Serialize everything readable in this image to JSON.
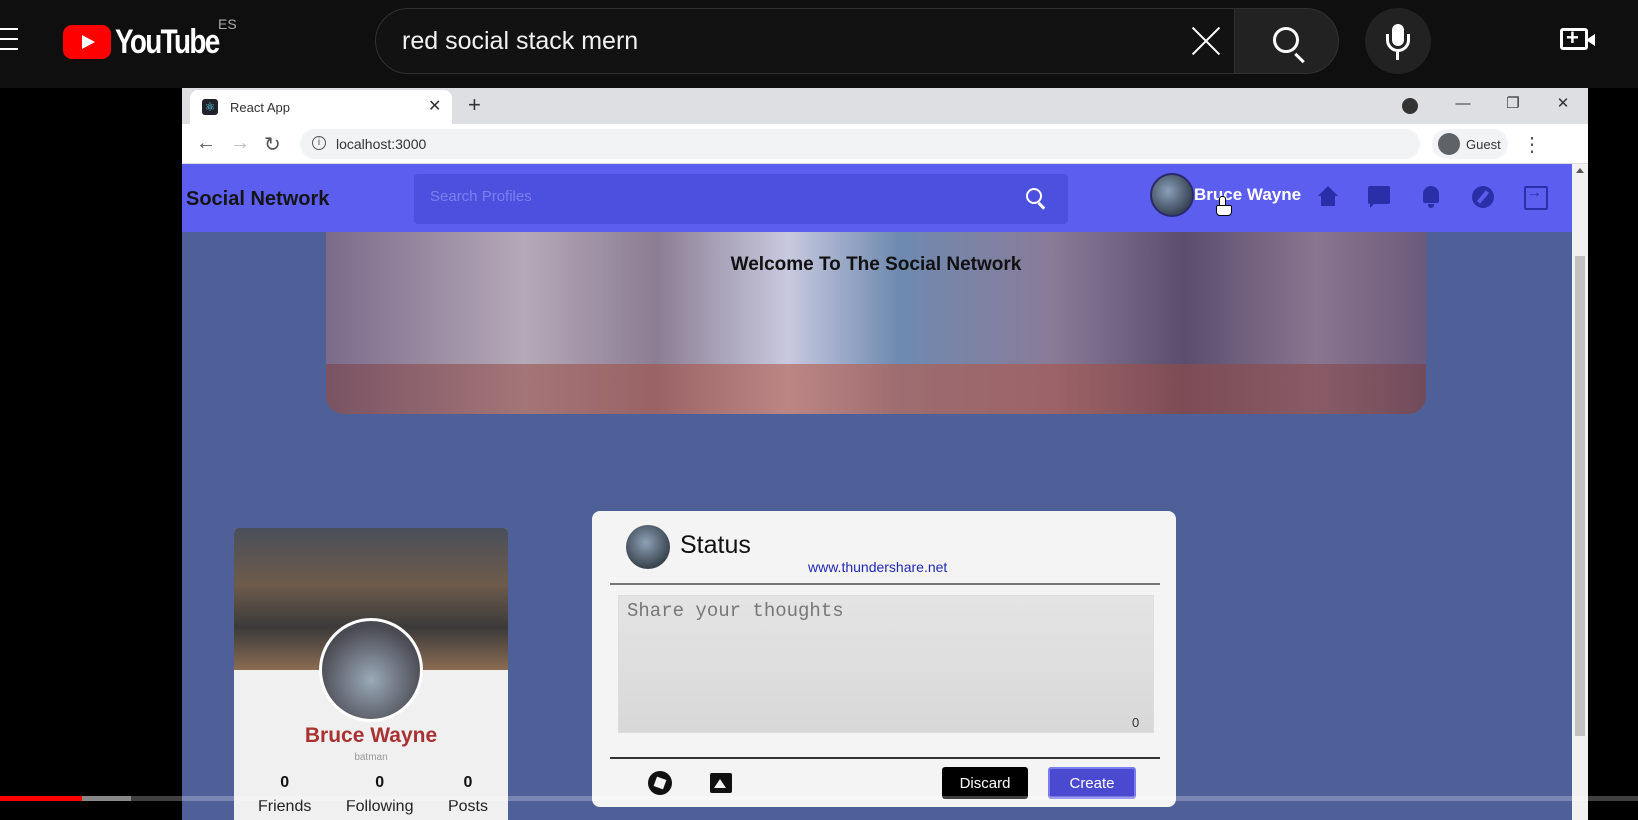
{
  "youtube": {
    "logo_text": "YouTube",
    "country_code": "ES",
    "search_query": "red social stack mern"
  },
  "browser": {
    "tab_title": "React App",
    "url": "localhost:3000",
    "profile_label": "Guest"
  },
  "app": {
    "brand": "Social Network",
    "search_placeholder": "Search Profiles",
    "nav_user_name": "Bruce Wayne",
    "banner_title": "Welcome To The Social Network",
    "profile": {
      "name": "Bruce Wayne",
      "handle": "batman",
      "stats": [
        {
          "value": "0",
          "label": "Friends"
        },
        {
          "value": "0",
          "label": "Following"
        },
        {
          "value": "0",
          "label": "Posts"
        }
      ]
    },
    "status": {
      "title": "Status",
      "link": "www.thundershare.net",
      "placeholder": "Share your thoughts",
      "char_count": "0",
      "discard_label": "Discard",
      "create_label": "Create"
    }
  },
  "video_progress": {
    "played_fraction": 0.05,
    "buffered_fraction": 0.08
  },
  "colors": {
    "youtube_red": "#ff0000",
    "app_nav": "#5c5ef0",
    "profile_name": "#a83232",
    "create_button": "#4a4ad0"
  }
}
